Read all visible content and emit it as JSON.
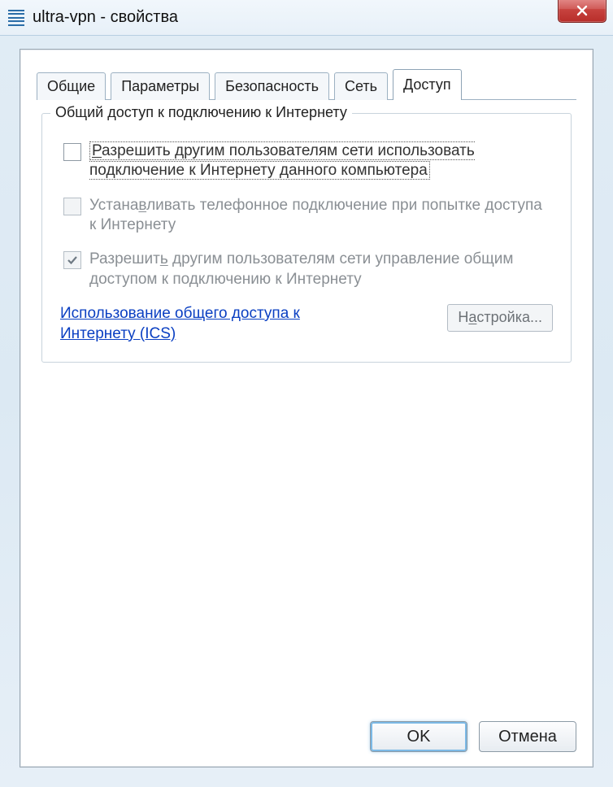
{
  "window": {
    "title": "ultra-vpn - свойства"
  },
  "tabs": [
    {
      "label": "Общие",
      "active": false
    },
    {
      "label": "Параметры",
      "active": false
    },
    {
      "label": "Безопасность",
      "active": false
    },
    {
      "label": "Сеть",
      "active": false
    },
    {
      "label": "Доступ",
      "active": true
    }
  ],
  "group": {
    "legend": "Общий доступ к подключению к Интернету",
    "opt1": {
      "pre": "",
      "accel": "Р",
      "post": "азрешить другим пользователям сети использовать подключение к Интернету данного компьютера",
      "checked": false,
      "disabled": false,
      "focused": true
    },
    "opt2": {
      "pre": "Устана",
      "accel": "в",
      "post": "ливать телефонное подключение при попытке доступа к Интернету",
      "checked": false,
      "disabled": true
    },
    "opt3": {
      "pre": "Разрешит",
      "accel": "ь",
      "post": " другим пользователям сети управление общим доступом к подключению к Интернету",
      "checked": true,
      "disabled": true
    },
    "link": "Использование общего доступа к Интернету (ICS)",
    "settings_btn": {
      "pre": "Н",
      "accel": "а",
      "post": "стройка..."
    }
  },
  "buttons": {
    "ok": "OK",
    "cancel": "Отмена"
  }
}
